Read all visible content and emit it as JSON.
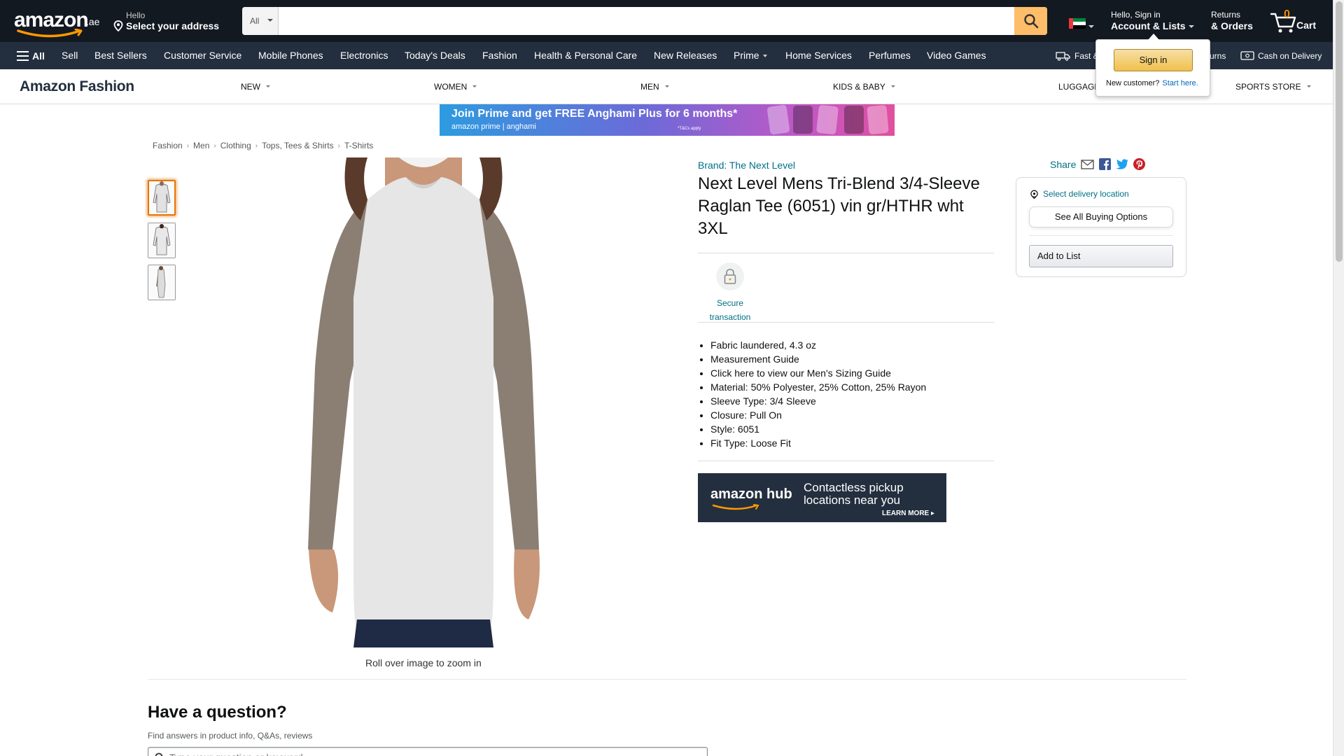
{
  "nav": {
    "logo_text": "amazon",
    "logo_tld": ".ae",
    "address_hello": "Hello",
    "address_label": "Select your address",
    "search_dept": "All",
    "search_value": "",
    "account_hello": "Hello, Sign in",
    "account_label": "Account & Lists",
    "returns_small": "Returns",
    "returns_big": "& Orders",
    "cart_count": "0",
    "cart_label": "Cart"
  },
  "subnav": {
    "all_label": "All",
    "items": [
      "Sell",
      "Best Sellers",
      "Customer Service",
      "Mobile Phones",
      "Electronics",
      "Today's Deals",
      "Fashion",
      "Health & Personal Care",
      "New Releases",
      "Prime",
      "Home Services",
      "Perfumes",
      "Video Games"
    ],
    "right_fast": "Fast &",
    "right_returns": "urns",
    "right_cod": "Cash on Delivery"
  },
  "flyout": {
    "signin_label": "Sign in",
    "new_customer": "New customer?",
    "start_here": "Start here."
  },
  "store": {
    "brand": "Amazon Fashion",
    "items": [
      "NEW",
      "WOMEN",
      "MEN",
      "KIDS & BABY",
      "LUGGAGE",
      "SPORTS STORE"
    ]
  },
  "banner": {
    "headline": "Join Prime and get FREE Anghami Plus for 6 months*",
    "sub": "amazon prime  |  anghami",
    "tc": "*T&Cs apply"
  },
  "breadcrumb": [
    "Fashion",
    "Men",
    "Clothing",
    "Tops, Tees & Shirts",
    "T-Shirts"
  ],
  "gallery": {
    "zoom_caption": "Roll over image to zoom in"
  },
  "product": {
    "brand": "Brand: The Next Level",
    "title": "Next Level Mens Tri-Blend 3/4-Sleeve Raglan Tee (6051) vin gr/HTHR wht 3XL",
    "secure_label": "Secure transaction",
    "bullets": [
      "Fabric laundered, 4.3 oz",
      "Measurement Guide",
      "Click here to view our Men's Sizing Guide",
      "Material: 50% Polyester, 25% Cotton, 25% Rayon",
      "Sleeve Type: 3/4 Sleeve",
      "Closure: Pull On",
      "Style: 6051",
      "Fit Type: Loose Fit"
    ]
  },
  "hub_ad": {
    "logo": "amazon hub",
    "text_line1": "Contactless pickup",
    "text_line2": "locations near you",
    "more": "LEARN MORE ▸"
  },
  "share_label": "Share",
  "buybox": {
    "delivery": "Select delivery location",
    "buying_options": "See All Buying Options",
    "add_to_list": "Add to List"
  },
  "questions": {
    "title": "Have a question?",
    "sub": "Find answers in product info, Q&As, reviews",
    "placeholder": "Type your question or keyword"
  },
  "colors": {
    "nav_bg": "#131921",
    "subnav_bg": "#232f3e",
    "search_btn": "#febd69",
    "link": "#007185",
    "thumb_active": "#e77600"
  }
}
